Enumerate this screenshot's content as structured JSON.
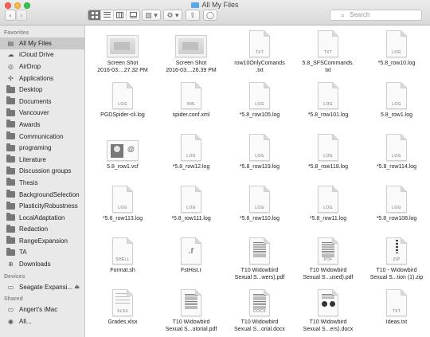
{
  "window": {
    "title": "All My Files"
  },
  "toolbar": {
    "back": "‹",
    "forward": "›",
    "views": [
      "icon-view",
      "list-view",
      "column-view",
      "cover-flow-view"
    ],
    "arrange": "▥ ▾",
    "action": "⚙ ▾",
    "share": "⇪",
    "tags": "◯",
    "search_placeholder": "Search"
  },
  "sidebar": {
    "favorites_header": "Favorites",
    "favorites": [
      {
        "label": "All My Files",
        "icon": "all-files-icon",
        "selected": true
      },
      {
        "label": "iCloud Drive",
        "icon": "cloud-icon"
      },
      {
        "label": "AirDrop",
        "icon": "airdrop-icon"
      },
      {
        "label": "Applications",
        "icon": "applications-icon"
      },
      {
        "label": "Desktop",
        "icon": "folder-icon"
      },
      {
        "label": "Documents",
        "icon": "folder-icon"
      },
      {
        "label": "Vancouver",
        "icon": "folder-icon"
      },
      {
        "label": "Awards",
        "icon": "folder-icon"
      },
      {
        "label": "Communication",
        "icon": "folder-icon"
      },
      {
        "label": "programing",
        "icon": "folder-icon"
      },
      {
        "label": "Literature",
        "icon": "folder-icon"
      },
      {
        "label": "Discussion groups",
        "icon": "folder-icon"
      },
      {
        "label": "Thesis",
        "icon": "folder-icon"
      },
      {
        "label": "BackgroundSelection",
        "icon": "folder-icon"
      },
      {
        "label": "PlasticityRobustness",
        "icon": "folder-icon"
      },
      {
        "label": "LocalAdaptation",
        "icon": "folder-icon"
      },
      {
        "label": "Redaction",
        "icon": "folder-icon"
      },
      {
        "label": "RangeExpansion",
        "icon": "folder-icon"
      },
      {
        "label": "TA",
        "icon": "folder-icon"
      },
      {
        "label": "Downloads",
        "icon": "downloads-icon"
      }
    ],
    "devices_header": "Devices",
    "devices": [
      {
        "label": "Seagate Expansi...",
        "icon": "drive-icon",
        "eject": "⏏"
      }
    ],
    "shared_header": "Shared",
    "shared": [
      {
        "label": "Angert's iMac",
        "icon": "imac-icon"
      },
      {
        "label": "All...",
        "icon": "network-icon"
      }
    ]
  },
  "files": [
    {
      "name": [
        "Screen Shot",
        "2016-03....27.32 PM"
      ],
      "kind": "screenshot"
    },
    {
      "name": [
        "Screen Shot",
        "2016-03....26.39 PM"
      ],
      "kind": "screenshot"
    },
    {
      "name": [
        "row10OnlyComands",
        ".txt"
      ],
      "kind": "doc",
      "ext": "TXT"
    },
    {
      "name": [
        "5.8_SFSCommands.",
        "txt"
      ],
      "kind": "doc",
      "ext": "TXT"
    },
    {
      "name": [
        "*5.8_row10.log"
      ],
      "kind": "doc",
      "ext": "LOG"
    },
    {
      "name": [
        "PGDSpider-cli.log"
      ],
      "kind": "doc",
      "ext": "LOG"
    },
    {
      "name": [
        "spider.conf.xml"
      ],
      "kind": "doc",
      "ext": "XML"
    },
    {
      "name": [
        "*5.8_row105.log"
      ],
      "kind": "doc",
      "ext": "LOG"
    },
    {
      "name": [
        "*5.8_row101.log"
      ],
      "kind": "doc",
      "ext": "LOG"
    },
    {
      "name": [
        "5.8_row1.log"
      ],
      "kind": "doc",
      "ext": "LOG"
    },
    {
      "name": [
        "5.8_row1.vcf"
      ],
      "kind": "vcard"
    },
    {
      "name": [
        "*5.8_row12.log"
      ],
      "kind": "doc",
      "ext": "LOG"
    },
    {
      "name": [
        "*5.8_row119.log"
      ],
      "kind": "doc",
      "ext": "LOG"
    },
    {
      "name": [
        "*5.8_row118.log"
      ],
      "kind": "doc",
      "ext": "LOG"
    },
    {
      "name": [
        "*5.8_row114.log"
      ],
      "kind": "doc",
      "ext": "LOG"
    },
    {
      "name": [
        "*5.8_row113.log"
      ],
      "kind": "doc",
      "ext": "LOG"
    },
    {
      "name": [
        "*5.8_row111.log"
      ],
      "kind": "doc",
      "ext": "LOG"
    },
    {
      "name": [
        "*5.8_row110.log"
      ],
      "kind": "doc",
      "ext": "LOG"
    },
    {
      "name": [
        "*5.8_row11.log"
      ],
      "kind": "doc",
      "ext": "LOG"
    },
    {
      "name": [
        "*5.8_row108.log"
      ],
      "kind": "doc",
      "ext": "LOG"
    },
    {
      "name": [
        "Format.sh"
      ],
      "kind": "doc",
      "ext": "SHELL"
    },
    {
      "name": [
        "FstHist.r"
      ],
      "kind": "r"
    },
    {
      "name": [
        "T10 Widowbird",
        "Sexual S...wers).pdf"
      ],
      "kind": "pdf"
    },
    {
      "name": [
        "T10 Widowbird",
        "Sexual S...used).pdf"
      ],
      "kind": "pdf",
      "ext": "PDF"
    },
    {
      "name": [
        "T10 - Widowbird",
        "Sexual S...tion (1).zip"
      ],
      "kind": "zip",
      "ext": "ZIP"
    },
    {
      "name": [
        "Grades.xlsx"
      ],
      "kind": "xlsx",
      "ext": "XLSX"
    },
    {
      "name": [
        "T10 Widowbird",
        "Sexual S...utorial.pdf"
      ],
      "kind": "pdf"
    },
    {
      "name": [
        "T10 Widowbird",
        "Sexual S...orial.docx"
      ],
      "kind": "pdf",
      "ext": "DOCX"
    },
    {
      "name": [
        "T10 Widowbird",
        "Sexual S...ers).docx"
      ],
      "kind": "docx-circles"
    },
    {
      "name": [
        "Ideas.txt"
      ],
      "kind": "doc",
      "ext": "TXT"
    }
  ]
}
